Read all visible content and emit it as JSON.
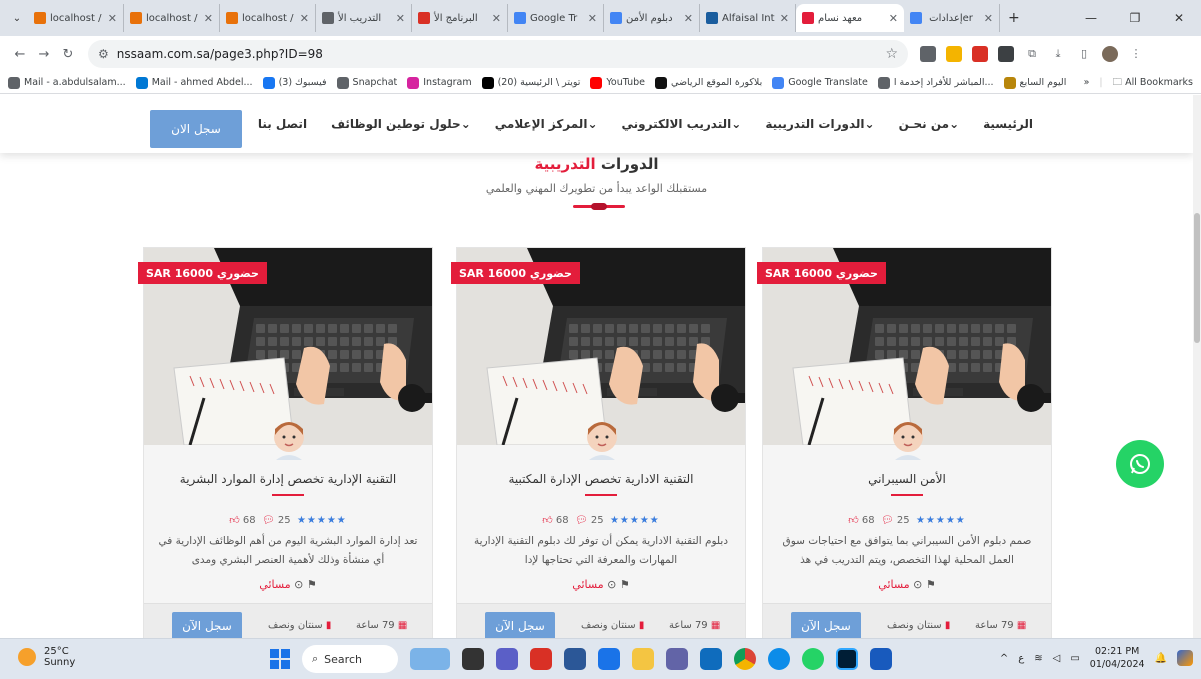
{
  "browser": {
    "tabs": [
      {
        "title": "localhost /",
        "color": "#e8710a"
      },
      {
        "title": "localhost /",
        "color": "#e8710a"
      },
      {
        "title": "localhost /",
        "color": "#e8710a"
      },
      {
        "title": "التدريب الأ",
        "color": "#5f6368"
      },
      {
        "title": "البرنامج الأ",
        "color": "#d93025"
      },
      {
        "title": "Google Tr",
        "color": "#4285f4"
      },
      {
        "title": "دبلوم الأمن",
        "color": "#4285f4"
      },
      {
        "title": "Alfaisal Int",
        "color": "#1a5d9e"
      },
      {
        "title": "معهد نسام",
        "color": "#e31d3b",
        "active": true
      },
      {
        "title": "إعدادات ‏er",
        "color": "#4285f4"
      }
    ],
    "new_tab": "+",
    "url": "nssaam.com.sa/page3.php?ID=98",
    "bookmarks": [
      {
        "label": "Mail - a.abdulsalam...",
        "color": "#5f6368"
      },
      {
        "label": "Mail - ahmed Abdel...",
        "color": "#0078d4"
      },
      {
        "label": "(3) فيسبوك",
        "color": "#1877f2"
      },
      {
        "label": "Snapchat",
        "color": "#5f6368"
      },
      {
        "label": "Instagram",
        "color": "#d6249f"
      },
      {
        "label": "(20) تويتر \\ الرئيسية",
        "color": "#000000"
      },
      {
        "label": "YouTube",
        "color": "#ff0000"
      },
      {
        "label": "بلاكورة الموقع الرياضي",
        "color": "#111111"
      },
      {
        "label": "Google Translate",
        "color": "#4285f4"
      },
      {
        "label": "المباشر للأفراد إخدمة ا...",
        "color": "#5f6368"
      },
      {
        "label": "اليوم السابع",
        "color": "#b8860b"
      }
    ],
    "bookmarks_more": "»",
    "all_bookmarks": "All Bookmarks"
  },
  "site": {
    "register_top": "سجل الان",
    "menu": [
      "الرئيسية",
      "من نحـن⌄",
      "الدورات التدريبية⌄",
      "التدريب الالكتروني⌄",
      "المركز الإعلامي⌄",
      "حلول توطين الوظائف⌄",
      "اتصل بنا"
    ],
    "heading_plain": "الدورات ",
    "heading_accent": "التدريبية",
    "subheading": "مستقبلك الواعد يبدأ من تطويرك المهني والعلمي"
  },
  "cards": [
    {
      "tag": "حضوري SAR 16000",
      "title": "التقنية الإدارية تخصص إدارة الموارد البشرية",
      "likes": "68",
      "comments": "25",
      "stars": "★★★★★",
      "desc": "تعد إدارة الموارد البشرية اليوم من أهم الوظائف الإدارية في أي منشأة وذلك لأهمية العنصر البشري ومدى",
      "period": "مسائي",
      "hours": "79 ساعة",
      "duration": "سنتان ونصف",
      "button": "سجل الآن"
    },
    {
      "tag": "حضوري SAR 16000",
      "title": "التقنية الادارية تخصص الإدارة المكتبية",
      "likes": "68",
      "comments": "25",
      "stars": "★★★★★",
      "desc": "دبلوم التقنية الادارية يمكن أن توفر لك دبلوم التقنية الإدارية المهارات والمعرفة التي تحتاجها لإدا",
      "period": "مسائي",
      "hours": "79 ساعة",
      "duration": "سنتان ونصف",
      "button": "سجل الآن"
    },
    {
      "tag": "حضوري SAR 16000",
      "title": "الأمن السيبراني",
      "likes": "68",
      "comments": "25",
      "stars": "★★★★★",
      "desc": "صمم دبلوم الأمن السيبراني بما يتوافق مع احتياجات سوق العمل المحلية لهذا التخصص، ويتم التدريب في هذ",
      "period": "مسائي",
      "hours": "79 ساعة",
      "duration": "سنتان ونصف",
      "button": "سجل الآن"
    }
  ],
  "taskbar": {
    "temp": "25°C",
    "condition": "Sunny",
    "search": "Search",
    "time": "02:21 PM",
    "date": "01/04/2024",
    "lang": "ع"
  },
  "colors": {
    "accent": "#e31d3b",
    "button": "#6e9fd8",
    "whatsapp": "#25d366"
  }
}
